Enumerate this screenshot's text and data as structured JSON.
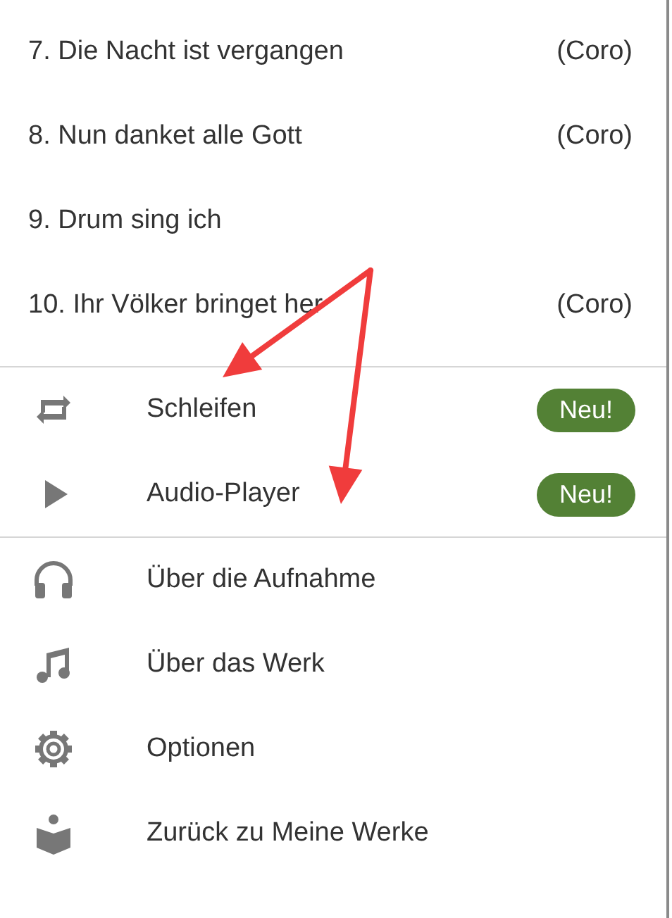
{
  "tracks": [
    {
      "title": "7. Die Nacht ist vergangen",
      "part": "(Coro)"
    },
    {
      "title": "8. Nun danket alle Gott",
      "part": "(Coro)"
    },
    {
      "title": "9. Drum sing ich"
    },
    {
      "title": "10. Ihr Völker bringet her",
      "part": "(Coro)"
    }
  ],
  "menu_sections": [
    {
      "items": [
        {
          "label": "Schleifen",
          "badge": "Neu!"
        },
        {
          "label": "Audio-Player",
          "badge": "Neu!"
        }
      ]
    },
    {
      "items": [
        {
          "label": "Über die Aufnahme"
        },
        {
          "label": "Über das Werk"
        },
        {
          "label": "Optionen"
        },
        {
          "label": "Zurück zu Meine Werke"
        }
      ]
    }
  ]
}
